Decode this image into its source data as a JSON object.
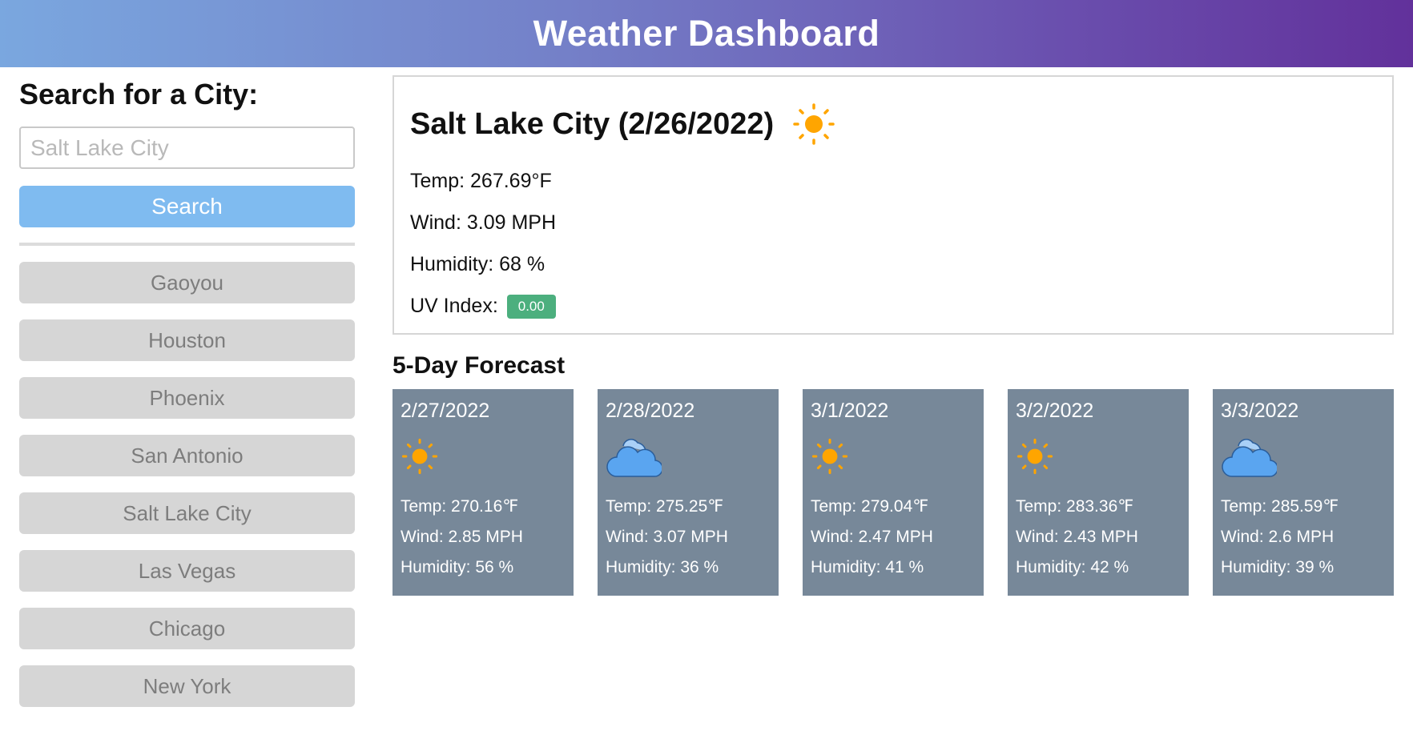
{
  "header": {
    "title": "Weather Dashboard"
  },
  "sidebar": {
    "heading": "Search for a City:",
    "search_placeholder": "Salt Lake City",
    "search_value": "",
    "search_button": "Search",
    "history": [
      "Gaoyou",
      "Houston",
      "Phoenix",
      "San Antonio",
      "Salt Lake City",
      "Las Vegas",
      "Chicago",
      "New York"
    ]
  },
  "current": {
    "title": "Salt Lake City (2/26/2022)",
    "icon": "sun-icon",
    "temp": "Temp: 267.69°F",
    "wind": "Wind: 3.09 MPH",
    "humidity": "Humidity: 68 %",
    "uv_label": "UV Index:",
    "uv_value": "0.00",
    "uv_color": "#4caf7e"
  },
  "forecast": {
    "heading": "5-Day Forecast",
    "card_color": "#778899",
    "days": [
      {
        "date": "2/27/2022",
        "icon": "sun-icon",
        "temp": "Temp: 270.16℉",
        "wind": "Wind: 2.85 MPH",
        "humidity": "Humidity: 56 %"
      },
      {
        "date": "2/28/2022",
        "icon": "cloud-icon",
        "temp": "Temp: 275.25℉",
        "wind": "Wind: 3.07 MPH",
        "humidity": "Humidity: 36 %"
      },
      {
        "date": "3/1/2022",
        "icon": "sun-icon",
        "temp": "Temp: 279.04℉",
        "wind": "Wind: 2.47 MPH",
        "humidity": "Humidity: 41 %"
      },
      {
        "date": "3/2/2022",
        "icon": "sun-icon",
        "temp": "Temp: 283.36℉",
        "wind": "Wind: 2.43 MPH",
        "humidity": "Humidity: 42 %"
      },
      {
        "date": "3/3/2022",
        "icon": "cloud-icon",
        "temp": "Temp: 285.59℉",
        "wind": "Wind: 2.6 MPH",
        "humidity": "Humidity: 39 %"
      }
    ]
  }
}
